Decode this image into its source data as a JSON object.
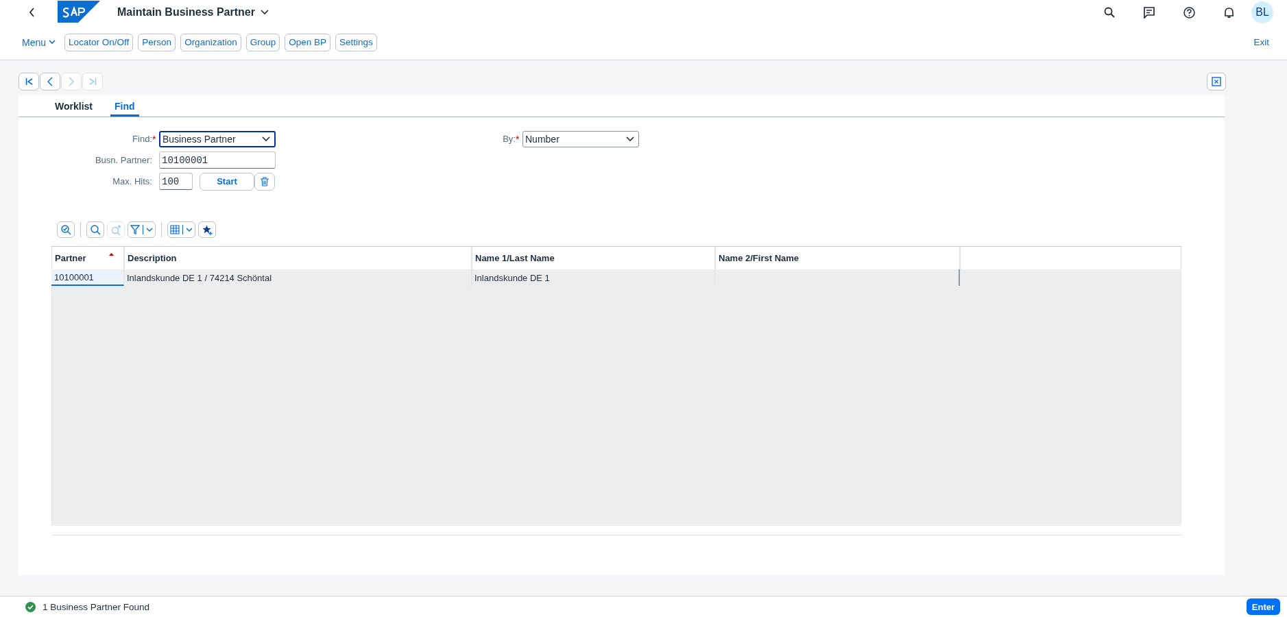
{
  "shell": {
    "title": "Maintain Business Partner",
    "user_initials": "BL"
  },
  "toolbar": {
    "menu": "Menu",
    "buttons": [
      "Locator On/Off",
      "Person",
      "Organization",
      "Group",
      "Open BP",
      "Settings"
    ],
    "exit": "Exit"
  },
  "nav_buttons": [
    {
      "kind": "first",
      "disabled": false
    },
    {
      "kind": "prev",
      "disabled": false
    },
    {
      "kind": "next",
      "disabled": true
    },
    {
      "kind": "last",
      "disabled": true
    }
  ],
  "tabs": [
    {
      "label": "Worklist",
      "selected": false
    },
    {
      "label": "Find",
      "selected": true
    }
  ],
  "form": {
    "find": {
      "label": "Find:",
      "required_mark": "*",
      "value": "Business Partner"
    },
    "by": {
      "label": "By:",
      "required_mark": "*",
      "value": "Number"
    },
    "partner": {
      "label": "Busn. Partner:",
      "value": "10100001"
    },
    "max_hits": {
      "label": "Max. Hits:",
      "value": "100"
    },
    "start": "Start"
  },
  "table": {
    "columns": [
      {
        "label": "Partner",
        "sorted": true
      },
      {
        "label": "Description",
        "sorted": false
      },
      {
        "label": "Name 1/Last Name",
        "sorted": false
      },
      {
        "label": "Name 2/First Name",
        "sorted": false
      }
    ],
    "rows": [
      {
        "cells": [
          {
            "text": "10100001",
            "selected": true
          },
          {
            "text": "Inlandskunde DE 1 / 74214 Schöntal",
            "selected": false
          },
          {
            "text": "Inlandskunde DE 1",
            "selected": false
          },
          {
            "text": "",
            "selected": false
          }
        ]
      }
    ]
  },
  "status_bar": {
    "message": "1 Business Partner Found",
    "enter": "Enter"
  }
}
